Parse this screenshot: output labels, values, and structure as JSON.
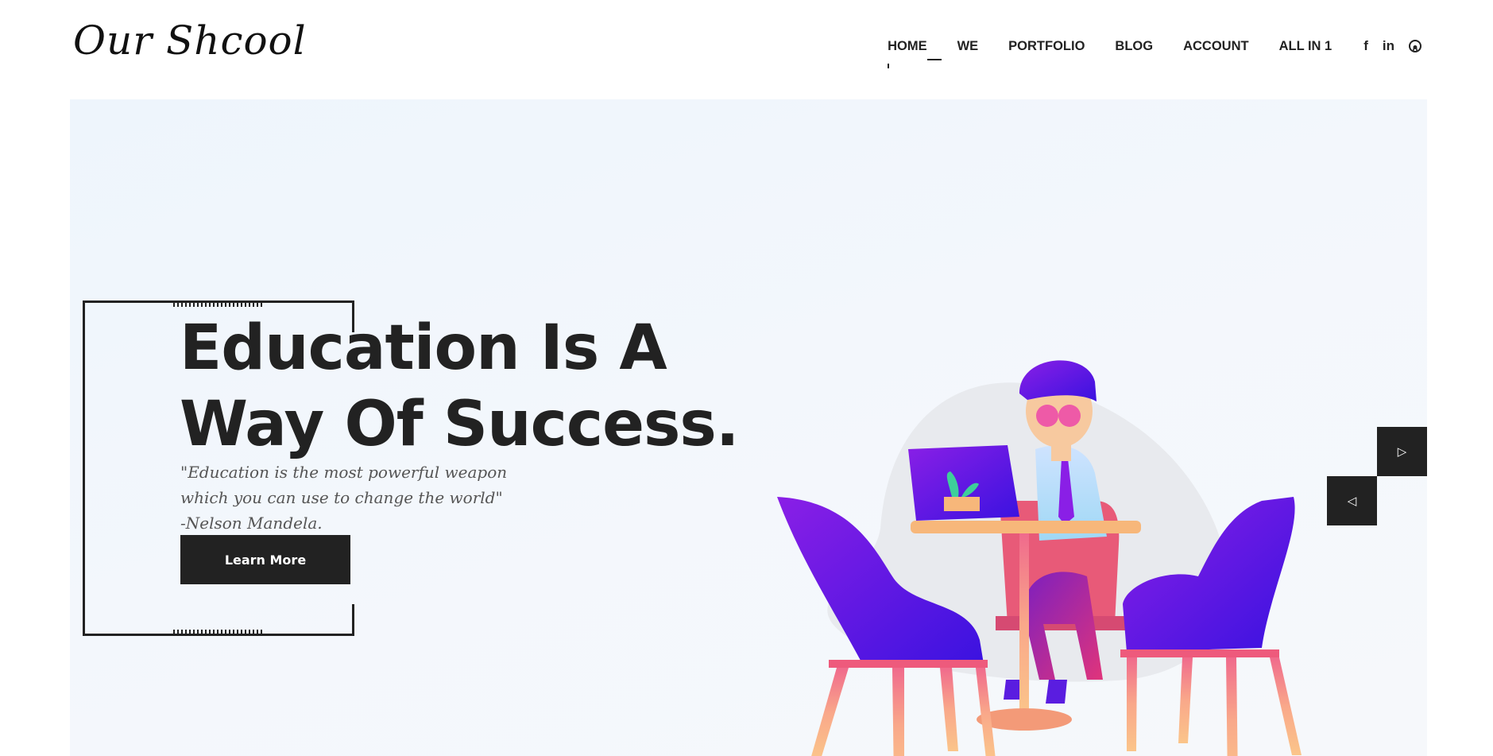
{
  "header": {
    "logo": "Our Shcool",
    "nav": [
      {
        "label": "HOME",
        "active": true
      },
      {
        "label": "WE"
      },
      {
        "label": "PORTFOLIO"
      },
      {
        "label": "BLOG"
      },
      {
        "label": "ACCOUNT"
      },
      {
        "label": "ALL IN 1"
      }
    ],
    "social": [
      {
        "icon": "facebook-icon",
        "glyph": "f"
      },
      {
        "icon": "linkedin-icon",
        "glyph": "in"
      },
      {
        "icon": "github-icon",
        "glyph": "◎"
      }
    ]
  },
  "hero": {
    "headline_line1": "Education Is A",
    "headline_line2": "Way Of Success.",
    "quote_line1": "\"Education is the most powerful weapon",
    "quote_line2": "which you can use to change the world\"",
    "quote_author": "-Nelson Mandela.",
    "button_label": "Learn More",
    "next_arrow_glyph": "▷",
    "prev_arrow_glyph": "◁"
  },
  "colors": {
    "text_dark": "#222222",
    "hero_bg": "#eff5fb",
    "chair_purple": "#5a1de0",
    "wood": "#f7b77a"
  }
}
